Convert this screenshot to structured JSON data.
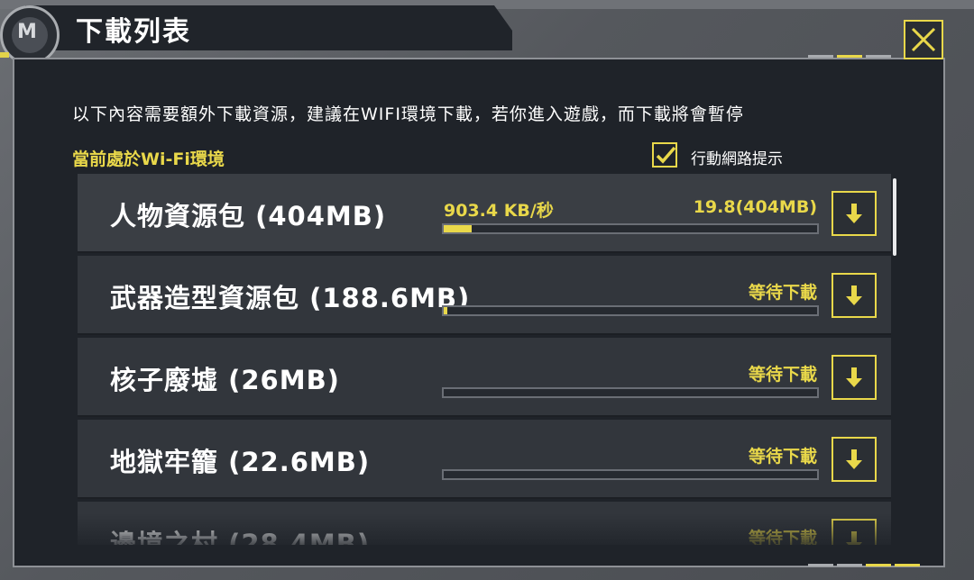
{
  "header": {
    "title": "下載列表",
    "logo_glyph": "M"
  },
  "notice": "以下內容需要額外下載資源，建議在WIFI環境下載，若你進入遊戲，而下載將會暫停",
  "wifi_status": "當前處於Wi-Fi環境",
  "mobile_network_prompt": {
    "label": "行動網路提示",
    "checked": true
  },
  "downloads": [
    {
      "name": "人物資源包 (404MB)",
      "speed": "903.4 KB/秒",
      "progress_text": "19.8(404MB)",
      "status": "",
      "progress": 0.075
    },
    {
      "name": "武器造型資源包 (188.6MB)",
      "speed": "",
      "progress_text": "",
      "status": "等待下載",
      "progress": 0.01
    },
    {
      "name": "核子廢墟 (26MB)",
      "speed": "",
      "progress_text": "",
      "status": "等待下載",
      "progress": 0
    },
    {
      "name": "地獄牢籠 (22.6MB)",
      "speed": "",
      "progress_text": "",
      "status": "等待下載",
      "progress": 0
    },
    {
      "name": "邊境之村 (28.4MB)",
      "speed": "",
      "progress_text": "",
      "status": "等待下載",
      "progress": 0
    }
  ],
  "colors": {
    "accent": "#e9d84a",
    "panel": "#1f2329",
    "row": "#32363c"
  },
  "icons": {
    "close": "close-x-icon",
    "download": "download-arrow-icon",
    "check": "checkmark-icon"
  }
}
